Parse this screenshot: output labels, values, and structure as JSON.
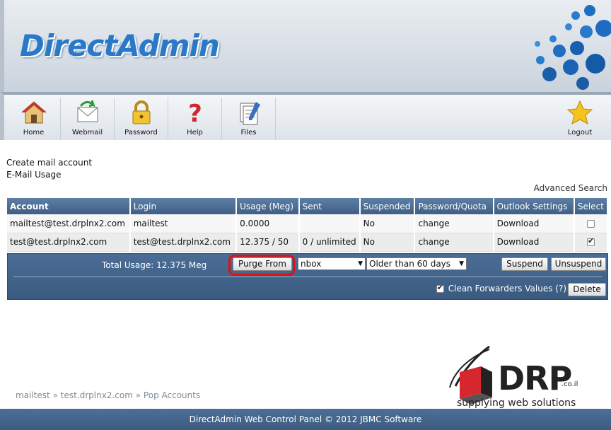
{
  "app": {
    "logo_text": "DirectAdmin"
  },
  "nav": {
    "items": [
      {
        "label": "Home",
        "icon": "house-icon"
      },
      {
        "label": "Webmail",
        "icon": "webmail-icon"
      },
      {
        "label": "Password",
        "icon": "lock-icon"
      },
      {
        "label": "Help",
        "icon": "question-icon"
      },
      {
        "label": "Files",
        "icon": "files-icon"
      }
    ],
    "logout": {
      "label": "Logout",
      "icon": "star-icon"
    }
  },
  "links": {
    "create_mail": "Create mail account",
    "email_usage": "E-Mail Usage",
    "advanced_search": "Advanced Search"
  },
  "table": {
    "headers": [
      "Account",
      "Login",
      "Usage (Meg)",
      "Sent",
      "Suspended",
      "Password/Quota",
      "Outlook Settings",
      "Select"
    ],
    "rows": [
      {
        "account": "mailtest@test.drplnx2.com",
        "login": "mailtest",
        "usage": "0.0000",
        "sent": "",
        "suspended": "No",
        "password": "change",
        "outlook": "Download",
        "selected": false
      },
      {
        "account": "test@test.drplnx2.com",
        "login": "test@test.drplnx2.com",
        "usage": "12.375 / 50",
        "sent": "0 / unlimited",
        "suspended": "No",
        "password": "change",
        "outlook": "Download",
        "selected": true
      }
    ]
  },
  "tools": {
    "total_usage": "Total Usage: 12.375 Meg",
    "purge_button": "Purge From",
    "folder_select": "nbox",
    "age_select": "Older than 60 days",
    "suspend_button": "Suspend",
    "unsuspend_button": "Unsuspend",
    "clean_forwarders": "Clean Forwarders Values (?)",
    "delete_button": "Delete"
  },
  "breadcrumb": [
    "mailtest",
    "test.drplnx2.com",
    "Pop Accounts"
  ],
  "breadcrumb_sep": "»",
  "drp": {
    "name": "DRP",
    "suffix": ".co.il",
    "tagline": "supplying web solutions"
  },
  "footer": "DirectAdmin Web Control Panel © 2012 JBMC Software",
  "colors": {
    "accent": "#3f5f86",
    "highlight": "#e01010",
    "logo": "#2a78c8"
  }
}
